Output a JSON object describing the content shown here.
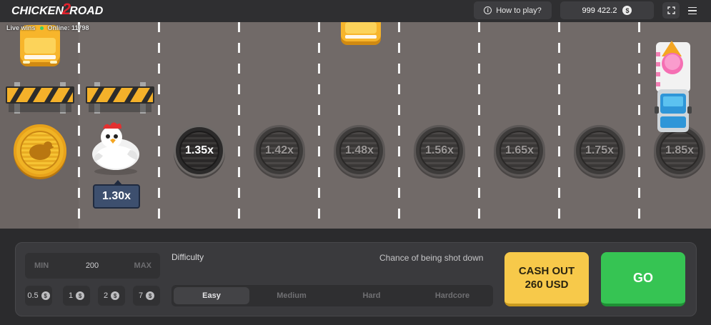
{
  "header": {
    "logo_part1": "CHICKEN",
    "logo_part2": "2",
    "logo_part3": "ROAD",
    "how_to_play": "How to play?",
    "info_icon": "i",
    "balance": "999 422.2",
    "currency_symbol": "$"
  },
  "live": {
    "label": "Live wins",
    "online": "Online: 11798"
  },
  "road": {
    "current_multiplier": "1.30x",
    "multipliers": [
      "1.35x",
      "1.42x",
      "1.48x",
      "1.56x",
      "1.65x",
      "1.75x",
      "1.85x"
    ]
  },
  "controls": {
    "min_label": "MIN",
    "bet_value": "200",
    "max_label": "MAX",
    "chips": [
      "0.5",
      "1",
      "2",
      "7"
    ],
    "chip_currency": "$",
    "difficulty_label": "Difficulty",
    "chance_label": "Chance of being shot down",
    "difficulties": [
      "Easy",
      "Medium",
      "Hard",
      "Hardcore"
    ],
    "selected_difficulty": "Easy",
    "cashout_line1": "CASH OUT",
    "cashout_line2": "260 USD",
    "go_label": "GO"
  },
  "colors": {
    "go_green": "#36c453",
    "cashout_yellow": "#f7c94a",
    "road_gray": "#716a68",
    "logo_red": "#e0232e"
  }
}
